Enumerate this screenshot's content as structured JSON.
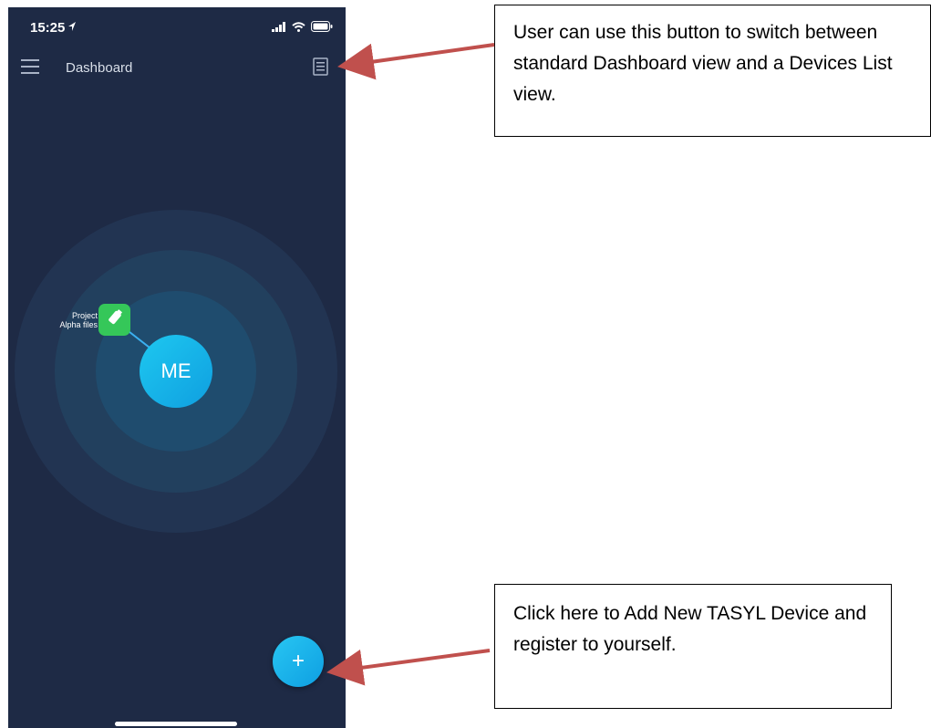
{
  "status_bar": {
    "time": "15:25"
  },
  "nav": {
    "title": "Dashboard",
    "menu_icon": "hamburger-menu-icon",
    "list_toggle_icon": "list-view-icon"
  },
  "dashboard": {
    "me_label": "ME",
    "device_label": "Project\nAlpha files",
    "device_icon": "usb-drive-icon"
  },
  "fab": {
    "label": "+"
  },
  "annotations": {
    "top": "User can use this button to switch between standard Dashboard view and a Devices List view.",
    "bottom": "Click here to Add New TASYL Device and register to yourself."
  },
  "colors": {
    "background": "#1e2a45",
    "accent": "#1ec8f0",
    "device": "#35c759",
    "arrow": "#c0504d"
  }
}
